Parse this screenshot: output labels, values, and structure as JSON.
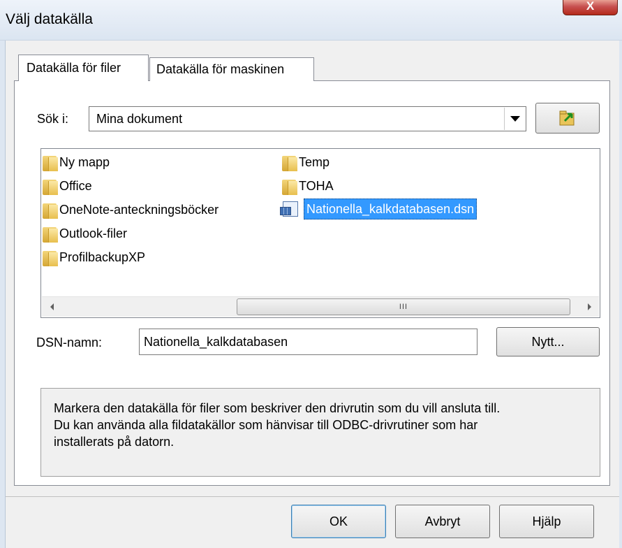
{
  "window": {
    "title": "Välj datakälla",
    "close_glyph": "X"
  },
  "tabs": [
    {
      "label": "Datakälla för filer",
      "active": true
    },
    {
      "label": "Datakälla för maskinen",
      "active": false
    }
  ],
  "lookin": {
    "label": "Sök i:",
    "value": "Mina dokument"
  },
  "files": {
    "column1": [
      {
        "name": "Ny mapp",
        "icon": "folder-icon"
      },
      {
        "name": "Office",
        "icon": "folder-icon"
      },
      {
        "name": "OneNote-anteckningsböcker",
        "icon": "folder-icon"
      },
      {
        "name": "Outlook-filer",
        "icon": "folder-icon"
      },
      {
        "name": "ProfilbackupXP",
        "icon": "folder-icon"
      }
    ],
    "column2": [
      {
        "name": "Temp",
        "icon": "folder-icon"
      },
      {
        "name": "TOHA",
        "icon": "folder-icon"
      },
      {
        "name": "Nationella_kalkdatabasen.dsn",
        "icon": "dsn-file-icon",
        "selected": true
      }
    ],
    "scroll_thumb_grip": "III"
  },
  "dsn": {
    "label": "DSN-namn:",
    "value": "Nationella_kalkdatabasen",
    "new_button": "Nytt..."
  },
  "description": [
    "Markera den datakälla för filer som beskriver den drivrutin som du vill ansluta till.",
    "Du kan använda alla fildatakällor som hänvisar till ODBC-drivrutiner som har",
    "installerats på datorn."
  ],
  "buttons": {
    "ok": "OK",
    "cancel": "Avbryt",
    "help": "Hjälp"
  },
  "colors": {
    "selection": "#3399ff",
    "close_button": "#c75050",
    "folder": "#e8bf4e"
  }
}
